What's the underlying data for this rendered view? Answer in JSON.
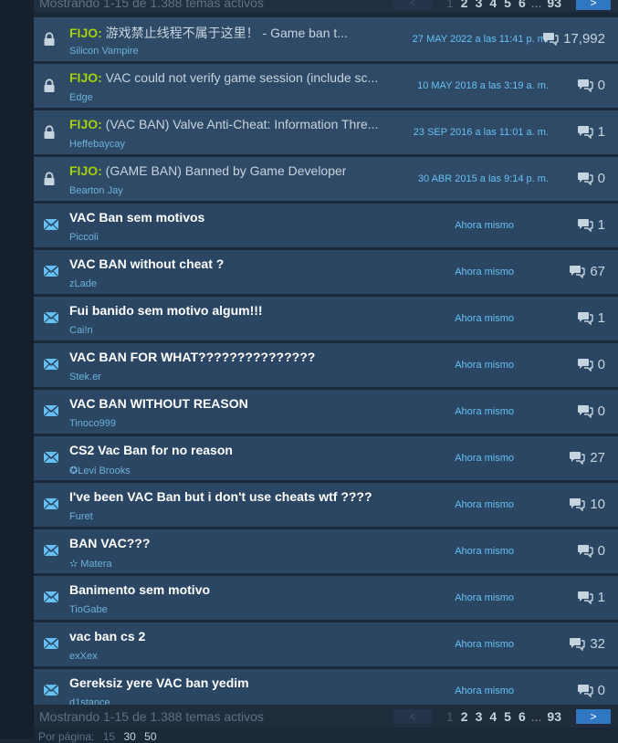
{
  "summary": "Mostrando 1-15 de 1.388 temas activos",
  "pagination": {
    "prev": "<",
    "pages": [
      "1",
      "2",
      "3",
      "4",
      "5",
      "6"
    ],
    "ellipsis": "...",
    "last": "93",
    "next": ">"
  },
  "per_page": {
    "label": "Por página:",
    "options": [
      "15",
      "30",
      "50"
    ]
  },
  "topics": [
    {
      "sticky": true,
      "prefix": "FIJO:",
      "title": "游戏禁止线程不属于这里！  - Game ban t...",
      "author": "Silicon Vampire",
      "time": "27 MAY 2022 a las 11:41 p. m.",
      "replies": "17,992"
    },
    {
      "sticky": true,
      "prefix": "FIJO:",
      "title": "VAC could not verify game session (include sc...",
      "author": "Edge",
      "time": "10 MAY 2018 a las 3:19 a. m.",
      "replies": "0"
    },
    {
      "sticky": true,
      "prefix": "FIJO:",
      "title": "(VAC BAN) Valve Anti-Cheat: Information Thre...",
      "author": "Heffebaycay",
      "time": "23 SEP 2016 a las 11:01 a. m.",
      "replies": "1"
    },
    {
      "sticky": true,
      "prefix": "FIJO:",
      "title": "(GAME BAN) Banned by Game Developer",
      "author": "Bearton Jay",
      "time": "30 ABR 2015 a las 9:14 p. m.",
      "replies": "0"
    },
    {
      "sticky": false,
      "prefix": "",
      "title": "VAC Ban sem motivos",
      "author": "Piccoli",
      "time": "Ahora mismo",
      "replies": "1"
    },
    {
      "sticky": false,
      "prefix": "",
      "title": "VAC BAN without cheat ?",
      "author": "zLade",
      "time": "Ahora mismo",
      "replies": "67"
    },
    {
      "sticky": false,
      "prefix": "",
      "title": "Fui banido sem motivo algum!!!",
      "author": "Cai!n",
      "time": "Ahora mismo",
      "replies": "1"
    },
    {
      "sticky": false,
      "prefix": "",
      "title": "VAC BAN FOR WHAT???????????????",
      "author": "Stek.er",
      "time": "Ahora mismo",
      "replies": "0"
    },
    {
      "sticky": false,
      "prefix": "",
      "title": "VAC BAN WITHOUT REASON",
      "author": "Tinoco999",
      "time": "Ahora mismo",
      "replies": "0"
    },
    {
      "sticky": false,
      "prefix": "",
      "title": "CS2 Vac Ban for no reason",
      "author": "✪Levi Brooks",
      "time": "Ahora mismo",
      "replies": "27"
    },
    {
      "sticky": false,
      "prefix": "",
      "title": "I've been VAC Ban but i don't use cheats wtf ????",
      "author": "Furet",
      "time": "Ahora mismo",
      "replies": "10"
    },
    {
      "sticky": false,
      "prefix": "",
      "title": "BAN VAC???",
      "author": "✫ Matera",
      "time": "Ahora mismo",
      "replies": "0"
    },
    {
      "sticky": false,
      "prefix": "",
      "title": "Banimento sem motivo",
      "author": "TioGabe",
      "time": "Ahora mismo",
      "replies": "1"
    },
    {
      "sticky": false,
      "prefix": "",
      "title": "vac ban cs 2",
      "author": "exXex",
      "time": "Ahora mismo",
      "replies": "32"
    },
    {
      "sticky": false,
      "prefix": "",
      "title": "Gereksiz yere VAC ban yedim",
      "author": "d1stance",
      "time": "Ahora mismo",
      "replies": "0"
    }
  ],
  "colors": {
    "accent": "#a4d007",
    "link": "#66c0f4",
    "row": "#2a4663",
    "next_button": "#2f77c1"
  },
  "icons": {
    "sticky": "lock-icon",
    "normal": "envelope-icon",
    "replies": "comment-bubble-icon"
  }
}
